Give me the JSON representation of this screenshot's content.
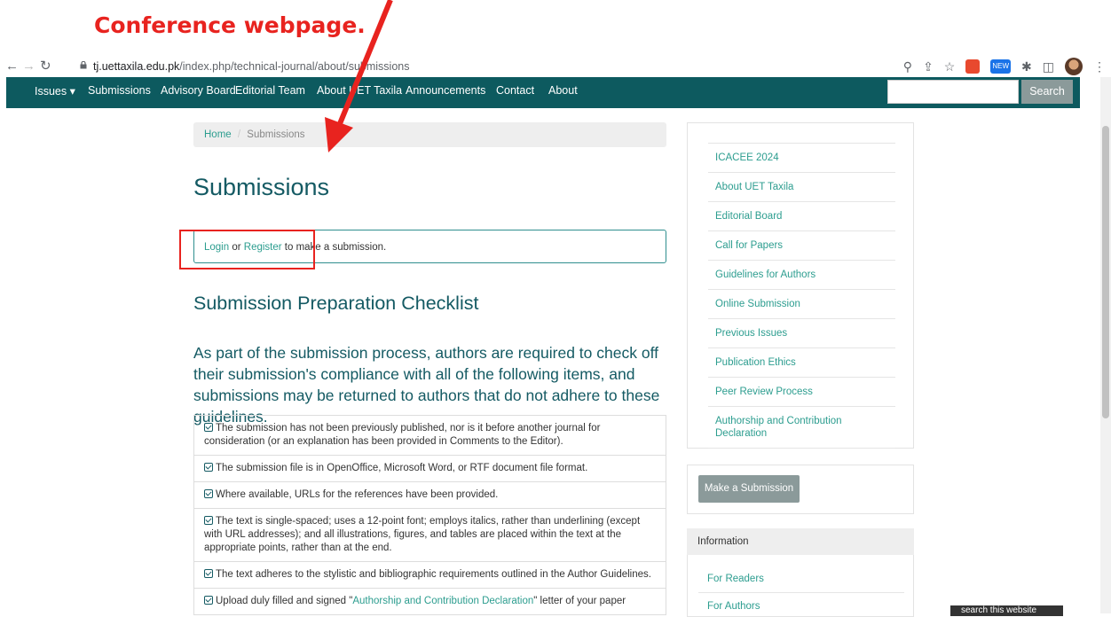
{
  "annotation": {
    "text": "Conference webpage.",
    "color": "#e8231f"
  },
  "browser": {
    "url_host": "tj.uettaxila.edu.pk",
    "url_path": "/index.php/technical-journal/about/submissions",
    "new_badge": "NEW",
    "ext_count": "1"
  },
  "nav": {
    "items": [
      "Issues ▾",
      "Submissions",
      "Advisory Board",
      "Editorial Team",
      "About UET Taxila",
      "Announcements",
      "Contact",
      "About"
    ],
    "search_button": "Search",
    "bg_color": "#0d5a5f"
  },
  "breadcrumb": {
    "home": "Home",
    "separator": "/",
    "current": "Submissions"
  },
  "main": {
    "title": "Submissions",
    "login_link": "Login",
    "or_text": " or ",
    "register_link": "Register",
    "login_suffix": " to make a submission.",
    "checklist_title": "Submission Preparation Checklist",
    "intro": "As part of the submission process, authors are required to check off their submission's compliance with all of the following items, and submissions may be returned to authors that do not adhere to these guidelines.",
    "checklist": [
      "The submission has not been previously published, nor is it before another journal for consideration (or an explanation has been provided in Comments to the Editor).",
      "The submission file is in OpenOffice, Microsoft Word, or RTF document file format.",
      "Where available, URLs for the references have been provided.",
      "The text is single-spaced; uses a 12-point font; employs italics, rather than underlining (except with URL addresses); and all illustrations, figures, and tables are placed within the text at the appropriate points, rather than at the end.",
      "The text adheres to the stylistic and bibliographic requirements outlined in the Author Guidelines."
    ],
    "last_item_prefix": "Upload duly filled and signed \"",
    "last_item_link": "Authorship and Contribution Declaration",
    "last_item_suffix": "\" letter of your paper"
  },
  "sidebar": {
    "links": [
      "ICACEE 2024",
      "About UET Taxila",
      "Editorial Board",
      "Call for Papers",
      "Guidelines for Authors",
      "Online Submission",
      "Previous Issues",
      "Publication Ethics",
      "Peer Review Process",
      "Authorship and Contribution Declaration"
    ],
    "make_submission": "Make a Submission",
    "info_title": "Information",
    "info_links": [
      "For Readers",
      "For Authors"
    ]
  },
  "site_search": "search this website",
  "colors": {
    "accent": "#2c9d8f",
    "heading": "#145a63",
    "annotation_red": "#e8231f"
  }
}
